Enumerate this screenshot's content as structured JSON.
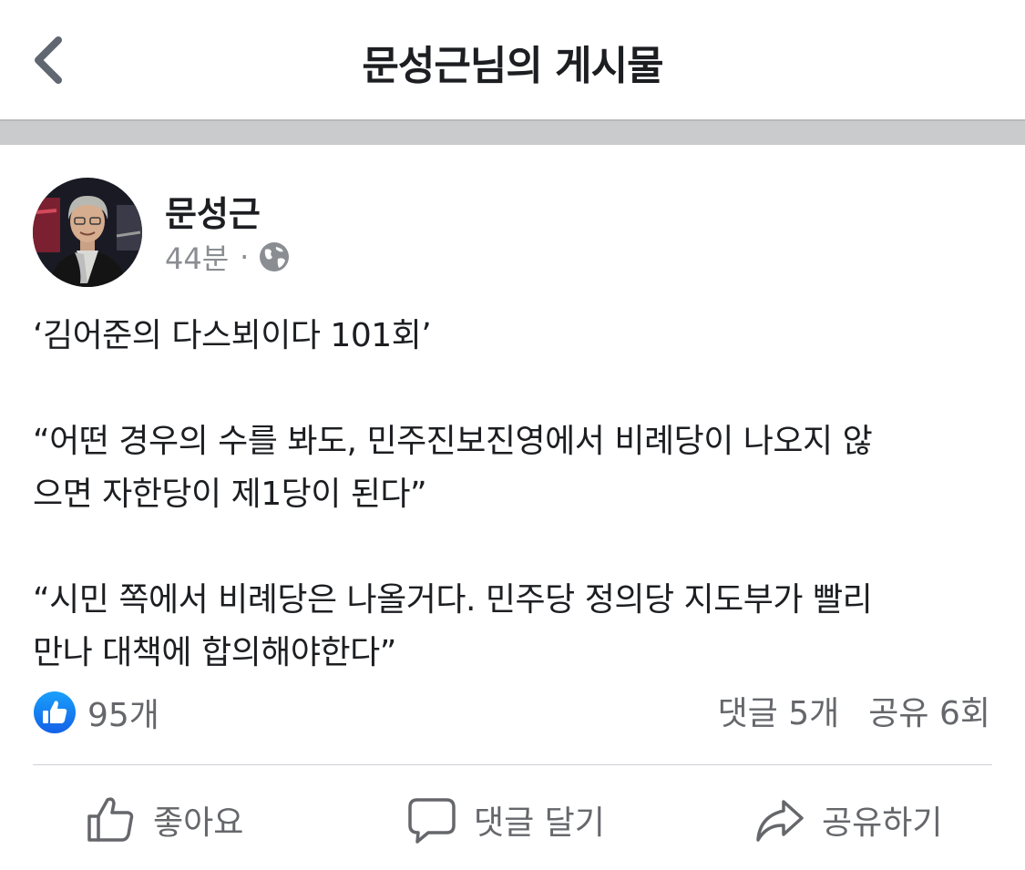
{
  "header": {
    "title": "문성근님의 게시물",
    "back_icon": "chevron-left-icon"
  },
  "post": {
    "author": "문성근",
    "time": "44분",
    "separator": "·",
    "privacy_icon": "globe-icon",
    "paragraphs": [
      "‘김어준의 다스뵈이다 101회’",
      "“어떤 경우의 수를 봐도, 민주진보진영에서 비례당이 나오지 않\n으면 자한당이 제1당이 된다”",
      "“시민 쪽에서 비례당은 나올거다. 민주당 정의당 지도부가 빨리\n만나 대책에 합의해야한다”"
    ]
  },
  "stats": {
    "like_icon": "thumbs-up-badge-icon",
    "likes": "95개",
    "comments": "댓글 5개",
    "shares": "공유 6회"
  },
  "actions": {
    "like": "좋아요",
    "comment": "댓글 달기",
    "share": "공유하기"
  },
  "colors": {
    "like_blue": "#1877f2",
    "secondary_text": "#65676b",
    "band_gray": "#cacbcd"
  }
}
